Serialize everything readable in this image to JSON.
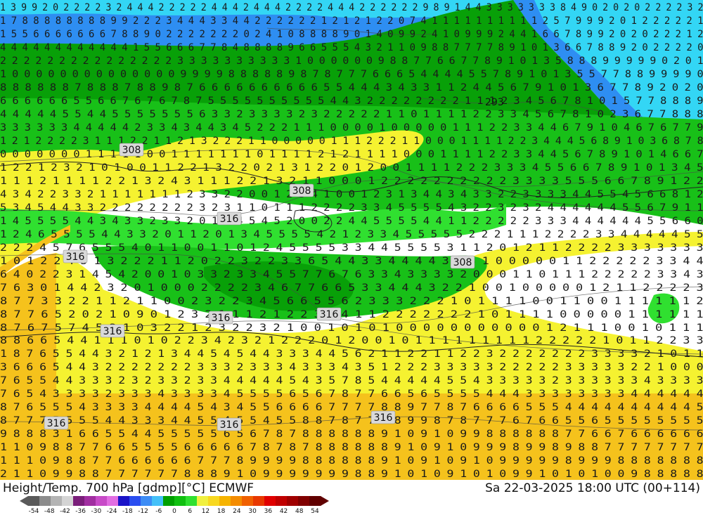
{
  "header": {
    "title": "Height/Temp. 700 hPa [gdmp][°C] ECMWF",
    "datetime": "Sa 22-03-2025 18:00 UTC (00+114)"
  },
  "contour_labels": [
    "308",
    "308",
    "316",
    "316",
    "308",
    "316",
    "316",
    "316",
    "316",
    "316",
    "316"
  ],
  "highlight_label": "293",
  "legend": {
    "ticks": [
      "-54",
      "-48",
      "-42",
      "-36",
      "-30",
      "-24",
      "-18",
      "-12",
      "-6",
      "0",
      "6",
      "12",
      "18",
      "24",
      "30",
      "36",
      "42",
      "48",
      "54"
    ],
    "colors": [
      "#5a5a5a",
      "#8c8c8c",
      "#b4b4b4",
      "#d4d4d4",
      "#7a1e7a",
      "#a12ea1",
      "#c84bc8",
      "#e26ee2",
      "#1a14c8",
      "#2a4ef0",
      "#3c8cf5",
      "#44c0f8",
      "#00a000",
      "#10c010",
      "#30e030",
      "#f0f040",
      "#f8d820",
      "#f6b400",
      "#f48c00",
      "#f06000",
      "#e83800",
      "#e00000",
      "#c00000",
      "#a00000",
      "#800000",
      "#600000"
    ],
    "map_colors": {
      "cyan": "#33d6f5",
      "blue": "#2e8ef2",
      "green_dark": "#08a008",
      "green": "#18c018",
      "green_light": "#30e030",
      "yellow": "#f5f230",
      "orange": "#f5c21c"
    }
  },
  "grid_rows": [
    "1 3 9 9 2 0 2 2 2 2 3 2 4 4 4 2 2 2 2 2 4 4 4 2 4 4 4 2 2 2 2 4 4 4 2 2 2 2 2 2 9 8 9 1 4 4 3 3 3 3 3 3 3 8 4 9 0 2 0 2 0 2 2 2 2 3 2",
    "1 7 8 8 8 8 8 8 8 8 9 9 2 2 2 3 4 4 4 3 3 4 4 2 2 2 2 2 2 1 2 1 2 1 2 2 0 7 4 1 1 1 1 1 1 1 1 1 1 2 5 7 9 9 9 2 0 1 2 2 2 2 2 1",
    "1 5 5 6 6 6 6 6 6 6 7 8 8 9 0 2 2 2 2 2 2 2 0 2 4 1 0 8 8 8 8 9 0 1 4 0 9 9 2 4 1 0 9 9 9 2 4 4 1 6 6 7 8 9 9 2 0 2 0 2 2 2 1 2",
    "4 4 4 4 4 4 4 4 4 4 4 4 1 5 5 6 6 6 7 7 8 4 8 8 8 8 9 6 6 5 5 5 4 3 2 1 1 0 9 8 8 7 7 7 7 8 9 1 0 1 3 6 6 7 8 8 9 2 0 2 2 2 2 0",
    "2 2 2 2 2 2 2 2 2 2 2 2 2 2 2 3 3 3 3 3 3 3 3 3 3 1 0 0 0 0 0 0 9 8 8 7 7 6 6 7 7 8 9 1 0 1 3 5 8 8 8 9 9 9 9 9 0 2 0 1",
    "1 0 0 0 0 0 0 0 0 0 0 0 0 0 0 9 9 9 9 8 8 8 8 8 9 8 7 8 7 7 7 6 6 6 5 4 4 4 4 5 5 7 8 9 1 0 1 3 5 5 7 7 8 8 9 9 9 9 0",
    "8 8 8 8 8 8 7 8 8 8 7 8 8 9 8 7 6 6 6 6 6 6 6 6 6 6 5 5 4 4 4 3 4 3 3 1 1 2 4 4 5 6 7 9 1 0 1 3 6 7 7 8 9 2 0 2 0",
    "6 6 6 6 6 6 5 5 6 6 7 6 7 6 7 8 7 5 5 5 5 5 5 5 5 5 5 4 4 3 2 2 2 2 2 2 2 2 1 1 1 2 3 4 5 6 7 8 1 0 1 5 7 7 8 8 8 9",
    "4 4 4 4 4 5 5 4 4 5 5 5 5 5 5 5 6 3 3 2 3 3 3 3 2 3 2 2 2 2 2 1 1 0 1 1 1 1 2 2 3 3 4 5 6 7 8 1 0 2 3 6 7 7 8 8 8",
    "3 3 3 3 3 3 4 4 4 4 4 2 3 3 4 3 4 4 3 4 5 2 2 2 1 1 1 0 0 0 0 1 0 0 0 0 0 1 1 1 2 2 3 3 4 4 6 7 9 1 0 4 6 7 6 7 7 9",
    "1 2 1 2 2 2 2 3 1 1 1 2 2 1 1 2 1 3 2 2 2 1 1 0 0 0 0 0 1 1 1 2 2 2 1 1 0 0 0 1 1 1 1 2 2 3 4 4 4 5 6 8 9 1 0 3 6 8 7 8",
    "0 0 0 0 0 0 0 1 1 1 1 1 0 0 1 1 1 1 1 1 1 0 1 1 1 1 2 1 2 1 1 1 1 0 0 0 1 1 1 1 2 2 3 3 4 4 5 6 7 8 9 1 0 1 4 6 6 7",
    "1 2 2 1 2 3 2 1 0 1 0 0 1 1 2 2 1 3 2 2 0 2 1 3 1 2 2 0 1 2 0 0 1 1 1 1 2 2 2 3 3 3 4 5 5 6 6 7 8 9 1 0 1 3 4 5",
    "1 1 1 2 1 1 1 1 2 2 1 3 2 4 3 1 1 1 2 2 1 3 2 1 1 0 0 0 1 2 2 2 2 2 2 2 2 2 2 3 3 3 3 5 5 5 6 6 7 8 9 1 2 2",
    "4 3 4 2 2 3 3 2 1 1 1 1 1 1 1 2 3 3 2 2 0 0 1 2 3 4 1 0 0 1 2 3 1 3 4 4 3 4 3 3 2 2 3 3 3 3 4 4 5 5 4 5 6 6 8 1 2",
    "5 3 4 5 4 4 3 3 2 2 2 2 2 2 2 2 3 2 3 1 1 0 1 1 1 2 2 2 2 3 3 4 5 5 5 5 4 3 2 2 3 2 3 2 4 4 4 4 4 4 5 5 6 7 9 1 1",
    "1 4 5 5 5 5 4 4 3 4 3 3 2 3 3 2 0 1 6 4 5 4 5 2 0 0 2 2 4 4 5 5 5 5 4 4 1 1 2 2 2 2 2 3 3 3 4 4 4 4 4 4 5 5 6 6 0",
    "1 2 4 6 5 5 5 5 4 4 3 3 2 0 1 1 2 0 1 3 4 5 5 5 5 4 2 1 2 3 3 4 5 5 5 5 5 2 2 2 1 1 1 2 2 2 2 3 3 4 4 4 4 4 5 5",
    "2 2 2 4 5 7 6 5 5 5 4 0 1 1 0 0 1 1 0 1 2 4 5 5 5 5 3 3 4 4 5 5 5 5 3 1 1 2 0 1 2 1 1 2 2 2 2 3 3 3 3 3 3 3",
    "1 0 1 2 2 4 5 1 3 2 2 2 1 1 2 0 2 2 3 2 2 3 3 6 5 4 4 3 3 4 4 4 4 3 3 3 1 0 0 0 0 0 1 1 2 2 2 2 2 3 3 4 4",
    "6 4 0 2 2 3 1 4 5 4 2 0 0 1 0 3 3 2 3 3 4 5 5 7 7 6 7 6 3 3 4 3 3 3 3 2 0 0 0 1 1 0 1 1 1 2 2 2 2 2 3 3 4 3",
    "7 6 3 0 1 4 4 2 3 2 0 1 0 0 0 2 2 2 2 3 4 6 7 7 6 6 5 3 3 4 4 4 3 2 2 1 0 0 1 0 0 0 0 0 1 2 1 1 2 2 2 2 3",
    "8 7 7 3 3 2 2 1 1 2 1 1 0 0 2 3 2 2 3 4 5 6 6 5 5 6 2 3 3 3 2 2 2 1 0 1 1 1 1 0 0 1 1 0 0 1 1 1 1 1 1 2",
    "8 7 7 6 5 2 0 2 1 0 9 0 1 2 3 2 1 1 1 2 1 2 2 3 4 4 1 1 2 2 2 2 2 2 2 1 0 1 1 1 1 0 0 0 0 0 1 1 1 1 1 1",
    "8 7 6 7 5 7 4 5 2 1 0 3 2 2 1 2 3 2 2 3 2 1 0 0 1 0 1 0 1 0 0 0 0 0 0 0 0 0 0 0 1 2 1 1 1 0 0 1 0 1 1 1",
    "8 8 6 6 5 4 4 1 1 1 0 1 0 2 2 3 4 2 3 2 1 2 2 2 0 1 2 0 0 1 0 1 1 1 1 1 1 1 1 1 2 2 2 2 2 1 0 1 1 2 2 3 3",
    "1 8 7 6 5 5 4 4 3 2 1 2 1 3 4 4 5 4 5 4 4 3 3 3 4 4 5 6 2 1 1 2 2 1 1 2 2 3 2 2 2 2 2 2 2 3 3 3 3 2 1 0 1 1",
    "3 6 6 6 5 4 4 3 2 2 2 2 2 2 2 3 3 3 2 3 3 3 4 3 3 3 4 3 5 1 2 2 2 3 3 3 3 3 2 2 2 2 2 3 3 3 3 3 2 2 1 0 0 0",
    "7 6 5 5 4 4 3 3 3 2 3 2 3 3 2 3 3 4 4 4 4 4 5 4 3 5 7 8 5 4 4 4 4 4 5 5 4 3 3 3 3 3 2 3 3 3 3 3 3 4 3 3 3 3",
    "7 6 5 4 3 3 3 3 2 3 3 3 4 3 3 3 3 4 5 5 5 5 6 5 6 7 8 7 7 6 6 5 6 5 5 5 5 4 4 4 3 3 3 3 3 3 3 3 4 4 4 4 4 4",
    "8 7 6 5 5 5 4 3 3 3 3 4 4 4 4 5 4 3 4 5 5 6 6 6 6 7 7 7 7 8 8 9 7 7 8 7 6 6 6 6 5 5 5 4 4 4 4 4 4 4 4 4 4 5",
    "8 7 7 7 5 5 5 5 4 4 3 3 3 4 4 5 5 4 5 5 4 5 5 8 8 7 8 7 7 8 8 9 9 8 7 8 7 7 7 6 7 6 6 5 5 6 5 5 5 5 5 5 5 5",
    "9 8 8 8 3 1 6 6 5 5 4 4 5 5 5 5 5 6 5 6 7 8 7 8 8 8 8 8 8 9 1 0 9 1 0 9 9 8 8 8 8 8 8 7 7 6 6 7 6 6 6 6 6 6",
    "1 1 0 9 8 8 7 7 6 6 5 5 5 5 6 6 6 6 6 7 8 7 8 7 8 8 8 8 8 8 9 1 0 9 1 0 9 9 9 8 9 9 8 9 8 8 7 7 7 7 7 7 7 7",
    "1 1 1 0 9 8 8 7 7 6 6 6 6 6 6 7 7 7 8 9 9 9 9 8 8 8 8 8 8 9 1 0 9 1 0 9 1 0 9 9 9 9 9 8 9 9 9 8 8 8 8 8 8 8",
    "2 1 1 0 9 9 8 8 7 7 7 7 7 7 8 8 8 9 1 0 9 9 9 9 9 9 9 8 8 9 1 0 1 0 9 1 0 1 0 9 9 1 0 1 0 1 0 0 9 8 8 8 8 8"
  ]
}
